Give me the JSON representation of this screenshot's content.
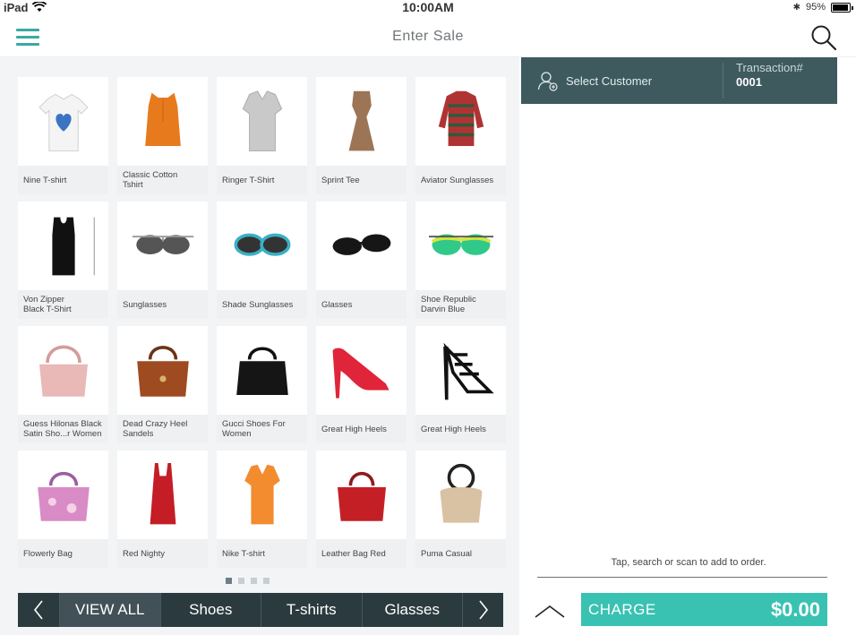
{
  "statusbar": {
    "device": "iPad",
    "time": "10:00AM",
    "battery": "95%"
  },
  "navbar": {
    "title": "Enter Sale"
  },
  "products": [
    {
      "name": "Nine T-shirt",
      "icon": "white-tshirt-image"
    },
    {
      "name": "Classic Cotton\nTshirt",
      "icon": "orange-top-image"
    },
    {
      "name": "Ringer T-Shirt",
      "icon": "grey-shirt-image"
    },
    {
      "name": "Sprint Tee",
      "icon": "brown-dress-image"
    },
    {
      "name": "Aviator Sunglasses",
      "icon": "striped-sweater-image"
    },
    {
      "name": "Von Zipper\nBlack T-Shirt",
      "icon": "black-tank-image"
    },
    {
      "name": "Sunglasses",
      "icon": "aviator-sunglasses-image"
    },
    {
      "name": "Shade Sunglasses",
      "icon": "teal-sunglasses-image"
    },
    {
      "name": "Glasses",
      "icon": "black-sunglasses-image"
    },
    {
      "name": "Shoe Republic\nDarvin Blue",
      "icon": "mirror-sunglasses-image"
    },
    {
      "name": "Guess Hilonas Black\nSatin Sho...r Women",
      "icon": "pink-handbag-image"
    },
    {
      "name": "Dead Crazy Heel\nSandels",
      "icon": "brown-handbag-image"
    },
    {
      "name": "Gucci Shoes For\nWomen",
      "icon": "black-handbag-image"
    },
    {
      "name": "Great High Heels",
      "icon": "red-heel-image"
    },
    {
      "name": "Great High Heels",
      "icon": "black-sandal-image"
    },
    {
      "name": "Flowerly Bag",
      "icon": "floral-bag-image"
    },
    {
      "name": "Red Nighty",
      "icon": "red-nighty-image"
    },
    {
      "name": "Nike T-shirt",
      "icon": "orange-polo-image"
    },
    {
      "name": "Leather Bag Red",
      "icon": "red-leather-bag-image"
    },
    {
      "name": "Puma  Casual",
      "icon": "cream-bag-image"
    }
  ],
  "pagination": {
    "pages": 4,
    "current": 1
  },
  "categories": {
    "items": [
      "VIEW ALL",
      "Shoes",
      "T-shirts",
      "Glasses"
    ],
    "active": 0
  },
  "order": {
    "select_customer": "Select Customer",
    "transaction_label": "Transaction#",
    "transaction_number": "0001",
    "hint": "Tap, search or scan to add to order.",
    "charge_label": "CHARGE",
    "charge_amount": "$0.00"
  },
  "colors": {
    "accent": "#39c2b2",
    "header_dark": "#3e5a5f",
    "catbar": "#2b3a3f"
  }
}
